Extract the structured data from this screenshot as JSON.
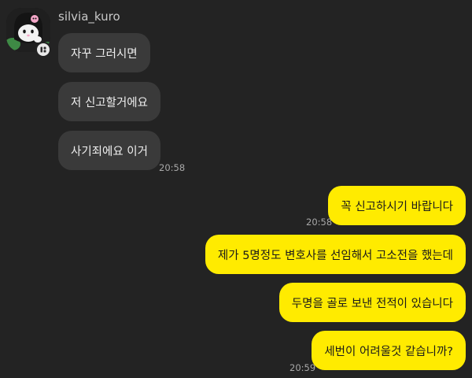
{
  "sender": {
    "name": "silvia_kuro"
  },
  "messages": [
    {
      "direction": "incoming",
      "text": "자꾸 그러시면"
    },
    {
      "direction": "incoming",
      "text": "저 신고할거에요"
    },
    {
      "direction": "incoming",
      "text": "사기죄에요 이거",
      "time": "20:58"
    },
    {
      "direction": "outgoing",
      "text": "꼭 신고하시기 바랍니다",
      "time": "20:58"
    },
    {
      "direction": "outgoing",
      "text": "제가 5명정도 변호사를 선임해서 고소전을 했는데"
    },
    {
      "direction": "outgoing",
      "text": "두명을 골로 보낸 전적이 있습니다"
    },
    {
      "direction": "outgoing",
      "text": "세번이 어려울것 같습니까?",
      "time": "20:59"
    }
  ],
  "colors": {
    "background": "#232323",
    "incoming_bubble": "#3a3a3a",
    "outgoing_bubble": "#ffeb00",
    "timestamp": "#a8a8a8"
  },
  "icons": {
    "avatar": "kuromi-character-avatar",
    "avatar_badge": "app-badge-icon"
  }
}
